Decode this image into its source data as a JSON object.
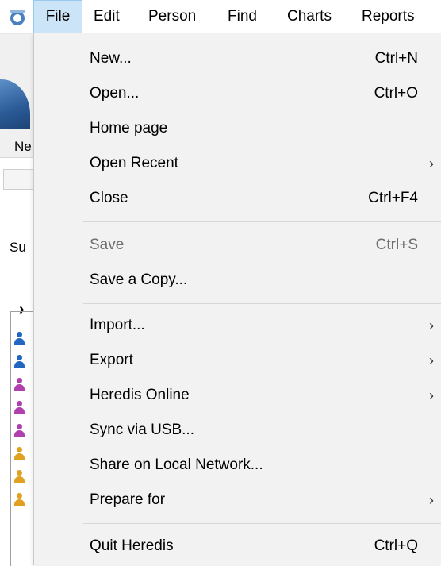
{
  "menubar": {
    "items": [
      "File",
      "Edit",
      "Person",
      "Find",
      "Charts",
      "Reports"
    ],
    "active": "File"
  },
  "background": {
    "new_tile_label": "Ne",
    "search_label": "Su",
    "chevron": "›",
    "person_icon_colors": [
      "#2166c0",
      "#2166c0",
      "#b040b0",
      "#b040b0",
      "#b040b0",
      "#e0a020",
      "#e0a020",
      "#e0a020"
    ]
  },
  "file_menu": {
    "new": {
      "label": "New...",
      "shortcut": "Ctrl+N"
    },
    "open": {
      "label": "Open...",
      "shortcut": "Ctrl+O"
    },
    "home_page": {
      "label": "Home page"
    },
    "open_recent": {
      "label": "Open Recent"
    },
    "close": {
      "label": "Close",
      "shortcut": "Ctrl+F4"
    },
    "save": {
      "label": "Save",
      "shortcut": "Ctrl+S",
      "disabled": true
    },
    "save_copy": {
      "label": "Save a Copy..."
    },
    "import": {
      "label": "Import..."
    },
    "export": {
      "label": "Export"
    },
    "heredis_online": {
      "label": "Heredis Online"
    },
    "sync_usb": {
      "label": "Sync via USB..."
    },
    "share_network": {
      "label": "Share on Local Network..."
    },
    "prepare_for": {
      "label": "Prepare for"
    },
    "quit": {
      "label": "Quit Heredis",
      "shortcut": "Ctrl+Q"
    },
    "submenu_arrow": "›"
  },
  "colors": {
    "menu_highlight": "#cce4f7",
    "dropdown_bg": "#f2f2f2"
  }
}
